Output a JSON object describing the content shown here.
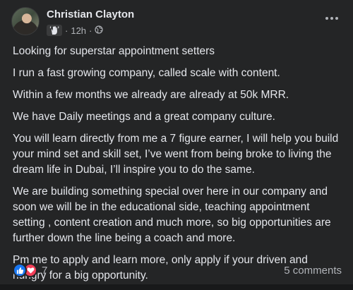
{
  "post": {
    "author": "Christian Clayton",
    "time": "12h",
    "separator": "·",
    "icons": {
      "avatar": "profile-photo",
      "badge": "waving-hand-icon",
      "audience": "globe-icon",
      "menu": "more-options-icon"
    },
    "paragraphs": [
      "Looking for superstar appointment setters",
      "I run a fast growing company, called scale with content.",
      "Within a few months we already are already at 50k MRR.",
      "We have Daily meetings and a great company culture.",
      "You will learn directly from me a 7 figure earner, I will help you build your mind set and skill set, I’ve went from being broke to living the dream life in Dubai, I’ll inspire you to do the same.",
      "We are building something special over here in our company and soon we will be in the educational side, teaching appointment setting , content creation and much more, so big opportunities are further down the line being a coach and more.",
      "Pm me to apply and learn more, only apply if your driven and hungry for a big opportunity."
    ]
  },
  "footer": {
    "reaction_count": "7",
    "reaction_icons": [
      "like-icon",
      "love-icon"
    ],
    "comments": "5 comments"
  },
  "colors": {
    "card_bg": "#242526",
    "text": "#e4e6eb",
    "muted": "#b0b3b8",
    "like": "#1877f2",
    "love": "#f33e58"
  }
}
